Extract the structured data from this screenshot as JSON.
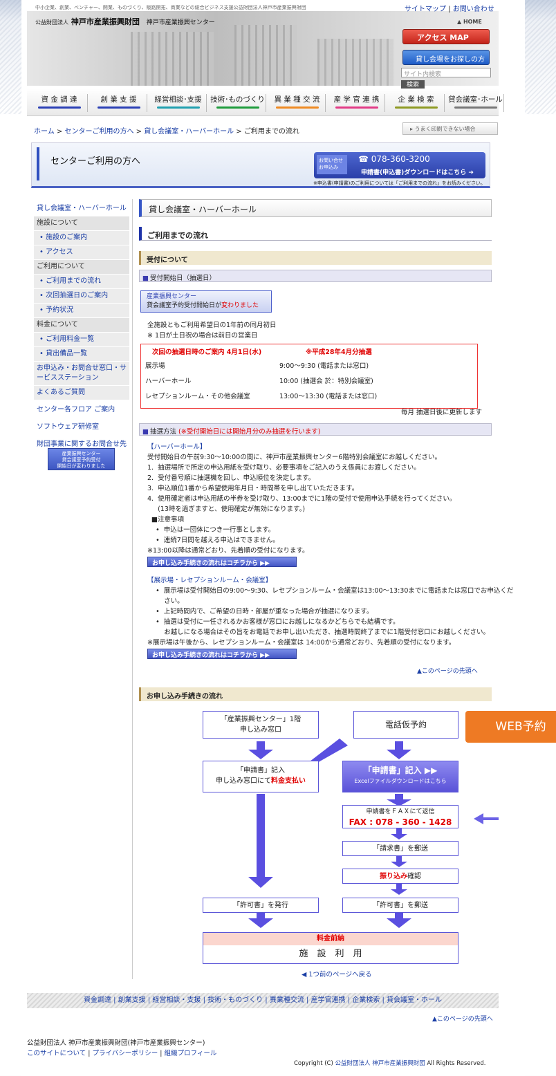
{
  "header": {
    "tagline": "中小企業、創業、ベンチャー、開業、ものづくり、販路開拓、商業などの総合ビジネス支援公益財団法人神戸市産業振興財団",
    "sitemap": "サイトマップ",
    "sep": "|",
    "contact": "お問い合わせ",
    "org_prefix": "公益財団法人",
    "org_name": "神戸市産業振興財団",
    "center": "神戸市産業振興センター",
    "home": "HOME",
    "access": "アクセス MAP",
    "find_room": "貸し会場をお探しの方へ",
    "search_placeholder": "サイト内検索",
    "search_btn": "検索"
  },
  "gnav": [
    "資 金 調 達",
    "創 業 支 援",
    "経営相談･支援",
    "技術･ものづくり",
    "異 業 種 交 流",
    "産 学 官 連 携",
    "企 業 検 索",
    "貸会議室･ホール"
  ],
  "breadcrumb": [
    "ホーム",
    "センターご利用の方へ",
    "貸し会議室・ハーバーホール",
    "ご利用までの流れ"
  ],
  "print": "うまく印刷できない場合",
  "band": {
    "title": "センターご利用の方へ",
    "label1": "お問い合せ",
    "label2": "お申込み",
    "tel": "☎ 078-360-3200",
    "download": "申請書(申込書)ダウンロードはこちら ➔",
    "note": "※申込書(申請書)のご利用については「ご利用までの流れ」をお読みください。"
  },
  "side": [
    {
      "c": "t",
      "l": "貸し会議室・ハーバーホール"
    },
    {
      "c": "g",
      "l": "施設について"
    },
    {
      "c": "s",
      "l": "• 施設のご案内"
    },
    {
      "c": "s",
      "l": "• アクセス"
    },
    {
      "c": "g",
      "l": "ご利用について"
    },
    {
      "c": "s",
      "l": "• ご利用までの流れ"
    },
    {
      "c": "s",
      "l": "• 次回抽選日のご案内"
    },
    {
      "c": "s",
      "l": "• 予約状況"
    },
    {
      "c": "g",
      "l": "料金について"
    },
    {
      "c": "s",
      "l": "• ご利用料金一覧"
    },
    {
      "c": "s",
      "l": "• 貸出備品一覧"
    },
    {
      "c": "w",
      "l": "お申込み・お問合せ窓口・サービスステーション"
    },
    {
      "c": "w",
      "l": "よくあるご質問"
    },
    {
      "c": "t",
      "l": "センター各フロア ご案内"
    },
    {
      "c": "t",
      "l": "ソフトウェア研修室"
    },
    {
      "c": "t",
      "l": "財団事業に関するお問合せ先"
    }
  ],
  "side_banner": [
    "産業振興センター",
    "貸会議室予約受付",
    "開始日が変わりました"
  ],
  "main": {
    "h2": "貸し会議室・ハーバーホール",
    "h3": "ご利用までの流れ",
    "h4a": "受付について",
    "h5a": "受付開始日（抽選日）",
    "banner1": "産業振興センター",
    "banner2": "貸会議室予約受付開始日が",
    "banner3": "変わりました",
    "p1": "全施設ともご利用希望日の1年前の同月初日",
    "p2": "※ 1日が土日祝の場合は前日の営業日",
    "box_title": "次回の抽選日時のご案内  4月1日(水)",
    "box_title2": "※平成28年4月分抽選",
    "rows": [
      [
        "展示場",
        "9:00〜9:30 (電話または窓口)"
      ],
      [
        "ハーバーホール",
        "10:00 (抽選会 於：特別会議室)"
      ],
      [
        "レセプションルーム・その他会議室",
        "13:00〜13:30 (電話または窓口)"
      ]
    ],
    "update": "毎月 抽選日後に更新します",
    "h5b": "抽選方法",
    "h5b_red": "(※受付開始日には開始月分のみ抽選を行います)",
    "harbor": "【ハーバーホール】",
    "hlines": [
      "受付開始日の午前9:30〜10:00の間に、神戸市産業振興センター6階特別会議室にお越しください。",
      "1.  抽選場所で所定の申込用紙を受け取り、必要事項をご記入のうえ係員にお渡しください。",
      "2.  受付番号順に抽選機を回し、申込順位を決定します。",
      "3.  申込順位1番から希望使用年月日・時間帯を申し出ていただきます。",
      "4.  使用確定者は申込用紙の半券を受け取り、13:00までに1階の受付で使用申込手続を行ってください。",
      "     (13時を過ぎますと、使用確定が無効になります。)",
      "  ■注意事項",
      "    •  申込は一団体につき一行事とします。",
      "    •  連続7日間を越える申込はできません。",
      "※13:00以降は通常どおり、先着順の受付になります。"
    ],
    "flow_btn": "お申し込み手続きの流れはコチラから  ▶▶",
    "exhibit": "【展示場・レセプションルーム・会議室】",
    "elines": [
      "    •  展示場は受付開始日の9:00〜9:30、レセプションルーム・会議室は13:00〜13:30までに電話または窓口でお申込くだ",
      "        さい。",
      "    •  上記時間内で、ご希望の日時・部屋が重なった場合が抽選になります。",
      "    •  抽選は受付に一任されるかお客様が窓口にお越しになるかどちらでも結構です。",
      "        お越しになる場合はその旨をお電話でお申し出いただき、抽選時間終了までに1階受付窓口にお越しください。",
      "※展示場は午後から、レセプションルーム・会議室は 14:00から通常どおり、先着順の受付になります。"
    ],
    "pagetop": "▲このページの先頭へ",
    "h4b": "お申し込み手続きの流れ"
  },
  "flow": {
    "b1a": "「産業振興センター」1階",
    "b1b": "申し込み窓口",
    "b2": "電話仮予約",
    "b3a": "「申請書」記入",
    "b3b": "申し込み窓口にて",
    "b3c": "料金支払い",
    "b4a": "「申請書」記入 ▶▶",
    "b4b": "Excelファイルダウンロードはこちら",
    "b5a": "申請書をＦＡＸにて返信",
    "b5b": "FAX : 078 - 360 - 1428",
    "b6": "「請求書」を郵送",
    "b7a": "振り込み",
    "b7b": "確認",
    "b8": "「許可書」を発行",
    "b9": "「許可書」を郵送",
    "b10a": "料金前納",
    "b10b": "施　設　利　用",
    "web": "WEB予約",
    "back": "◀ 1つ前のページへ戻る"
  },
  "footer": {
    "links": "資金調達 | 創業支援 | 経営相談・支援 | 技術・ものづくり | 異業種交流 | 産学官連携 | 企業検索 | 貸会議室・ホール",
    "pagetop": "▲このページの先頭へ",
    "org": "公益財団法人 神戸市産業振興財団(神戸市産業振興センター)",
    "about": "このサイトについて",
    "privacy": "プライバシーポリシー",
    "profile": "組織プロフィール",
    "copy": "Copyright (C) ",
    "copy_org": "公益財団法人 神戸市産業振興財団",
    "copy_end": " All Rights Reserved."
  }
}
